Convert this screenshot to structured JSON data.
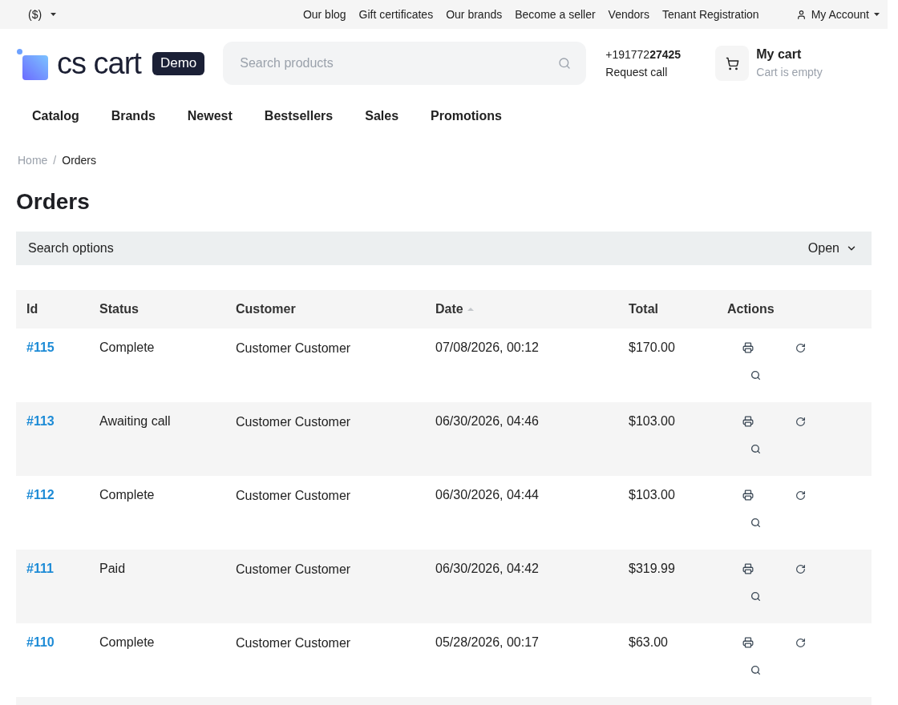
{
  "top_bar": {
    "currency": "($)",
    "links": [
      "Our blog",
      "Gift certificates",
      "Our brands",
      "Become a seller",
      "Vendors",
      "Tenant Registration"
    ],
    "account": "My Account"
  },
  "header": {
    "logo": "cs cart",
    "badge": "Demo",
    "search": {
      "placeholder": "Search products"
    },
    "phone": "+191772**27425**",
    "request_call": "Request call",
    "cart": {
      "title": "My cart",
      "status": "Cart is empty"
    }
  },
  "nav": [
    "Catalog",
    "Brands",
    "Newest",
    "Bestsellers",
    "Sales",
    "Promotions"
  ],
  "breadcrumbs": {
    "items": [
      "Home",
      "Orders"
    ],
    "separator": "/"
  },
  "page_title": "Orders",
  "search_options": {
    "label": "Search options",
    "toggle": "Open",
    "expanded": false
  },
  "table": {
    "columns": [
      {
        "label": "Id",
        "sorted": false
      },
      {
        "label": "Status",
        "sorted": false
      },
      {
        "label": "Customer",
        "sorted": false
      },
      {
        "label": "Date",
        "sorted": true
      },
      {
        "label": "Total",
        "sorted": false
      },
      {
        "label": "Actions",
        "sorted": false
      }
    ],
    "rows": [
      {
        "id": "#115",
        "status": "Complete",
        "customer": "Customer Customer",
        "date": "07/08/2026, 00:12",
        "total": "$170.00"
      },
      {
        "id": "#113",
        "status": "Awaiting call",
        "customer": "Customer Customer",
        "date": "06/30/2026, 04:46",
        "total": "$103.00"
      },
      {
        "id": "#112",
        "status": "Complete",
        "customer": "Customer Customer",
        "date": "06/30/2026, 04:44",
        "total": "$103.00"
      },
      {
        "id": "#111",
        "status": "Paid",
        "customer": "Customer Customer",
        "date": "06/30/2026, 04:42",
        "total": "$319.99"
      },
      {
        "id": "#110",
        "status": "Complete",
        "customer": "Customer Customer",
        "date": "05/28/2026, 00:17",
        "total": "$63.00"
      }
    ]
  }
}
